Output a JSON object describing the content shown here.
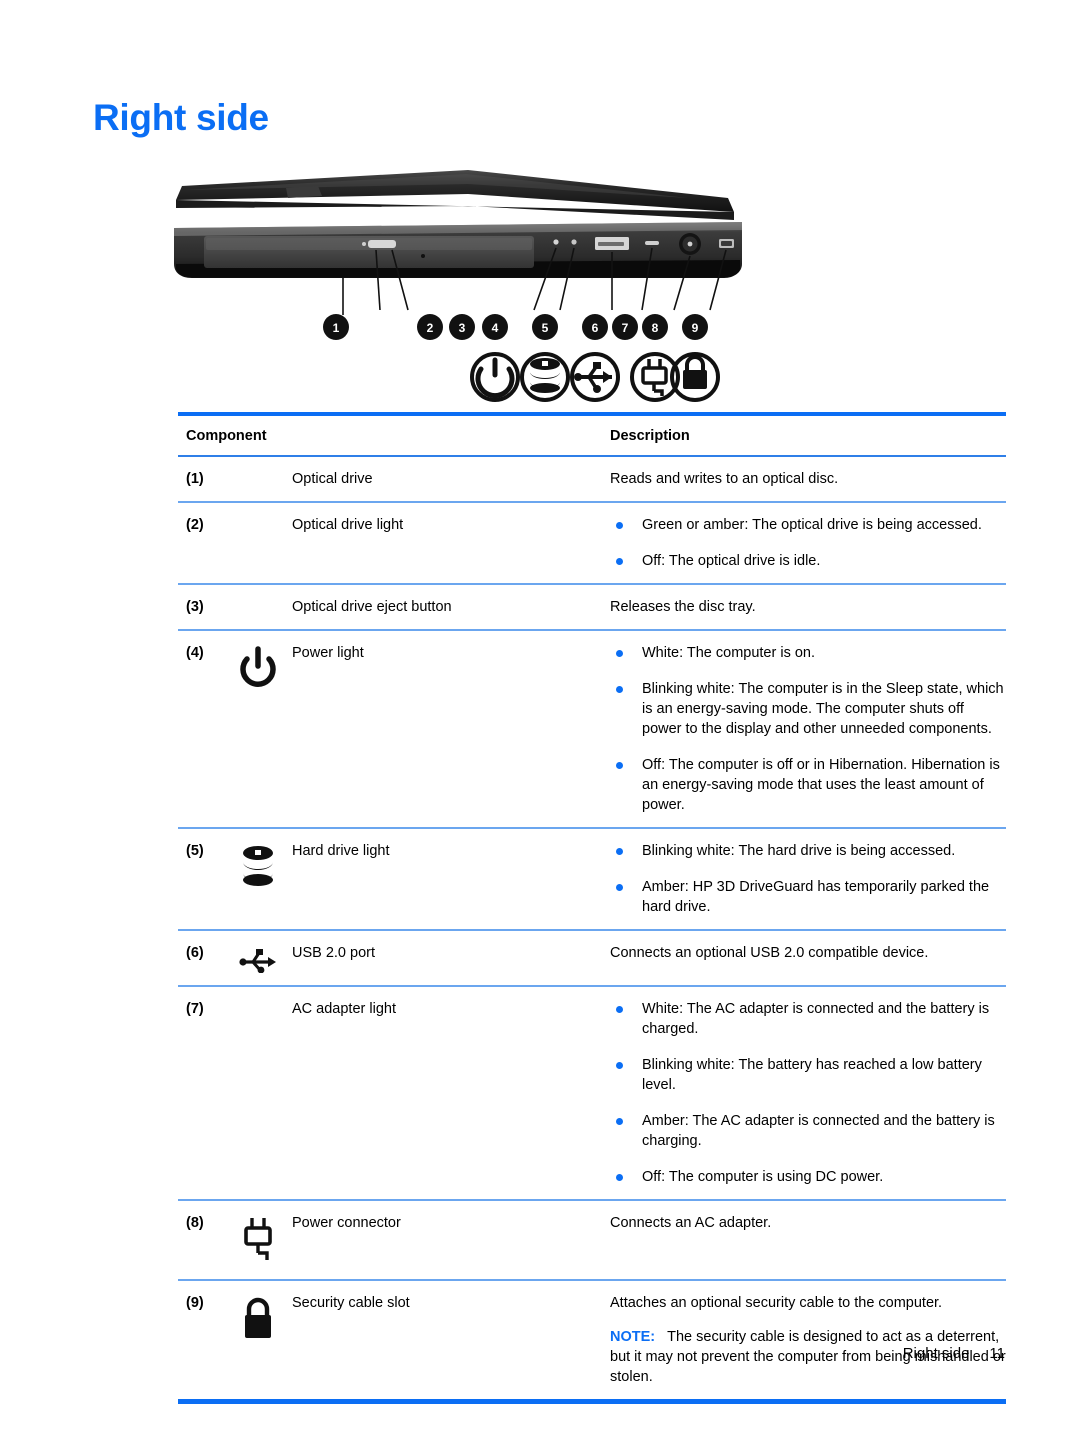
{
  "page": {
    "title": "Right side",
    "footer_section": "Right side",
    "footer_page_number": "11"
  },
  "colors": {
    "accent_blue": "#0b6ef4",
    "rule_light_blue": "#6ba6ef",
    "text_black": "#000000"
  },
  "illustration": {
    "alt_name": "laptop-right-side-photo",
    "callouts": [
      "1",
      "2",
      "3",
      "4",
      "5",
      "6",
      "7",
      "8",
      "9"
    ],
    "legend_icons": [
      "power-icon",
      "hard-drive-icon",
      "usb-icon",
      "power-connector-icon",
      "lock-icon"
    ]
  },
  "table": {
    "headers": {
      "component": "Component",
      "description": "Description"
    },
    "rows": [
      {
        "number": "(1)",
        "icon": "",
        "name": "Optical drive",
        "desc_type": "plain",
        "desc": "Reads and writes to an optical disc."
      },
      {
        "number": "(2)",
        "icon": "",
        "name": "Optical drive light",
        "desc_type": "bullets",
        "bullets": [
          "Green or amber: The optical drive is being accessed.",
          "Off: The optical drive is idle."
        ]
      },
      {
        "number": "(3)",
        "icon": "",
        "name": "Optical drive eject button",
        "desc_type": "plain",
        "desc": "Releases the disc tray."
      },
      {
        "number": "(4)",
        "icon": "power-icon",
        "name": "Power light",
        "desc_type": "bullets",
        "bullets": [
          "White: The computer is on.",
          "Blinking white: The computer is in the Sleep state, which is an energy-saving mode. The computer shuts off power to the display and other unneeded components.",
          "Off: The computer is off or in Hibernation. Hibernation is an energy-saving mode that uses the least amount of power."
        ]
      },
      {
        "number": "(5)",
        "icon": "hard-drive-icon",
        "name": "Hard drive light",
        "desc_type": "bullets",
        "bullets": [
          "Blinking white: The hard drive is being accessed.",
          "Amber: HP 3D DriveGuard has temporarily parked the hard drive."
        ]
      },
      {
        "number": "(6)",
        "icon": "usb-icon",
        "name": "USB 2.0 port",
        "desc_type": "plain",
        "desc": "Connects an optional USB 2.0 compatible device."
      },
      {
        "number": "(7)",
        "icon": "",
        "name": "AC adapter light",
        "desc_type": "bullets",
        "bullets": [
          "White: The AC adapter is connected and the battery is charged.",
          "Blinking white: The battery has reached a low battery level.",
          "Amber: The AC adapter is connected and the battery is charging.",
          "Off: The computer is using DC power."
        ]
      },
      {
        "number": "(8)",
        "icon": "power-connector-icon",
        "name": "Power connector",
        "desc_type": "plain",
        "desc": "Connects an AC adapter."
      },
      {
        "number": "(9)",
        "icon": "lock-icon",
        "name": "Security cable slot",
        "desc_type": "plain-note",
        "desc": "Attaches an optional security cable to the computer.",
        "note_label": "NOTE:",
        "note_text": "The security cable is designed to act as a deterrent, but it may not prevent the computer from being mishandled or stolen."
      }
    ]
  }
}
